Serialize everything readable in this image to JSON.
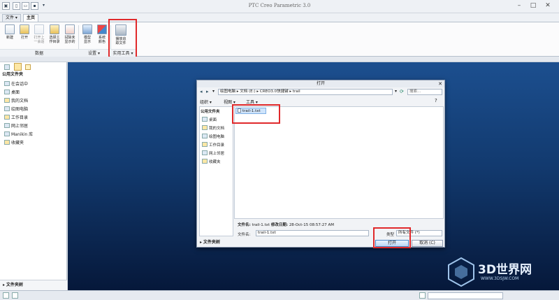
{
  "app": {
    "title": "PTC Creo Parametric 3.0"
  },
  "tabs": [
    {
      "label": "文件 ▾"
    },
    {
      "label": "主页"
    }
  ],
  "ribbon": {
    "buttons": [
      {
        "label": "新建"
      },
      {
        "label": "打开"
      },
      {
        "label": "打开上\n一会话"
      },
      {
        "label": "选择工\n作目录"
      },
      {
        "label": "拭除未\n显示的"
      },
      {
        "label": "模型\n显示"
      },
      {
        "label": "系统\n颜色"
      },
      {
        "label": "播放追\n踪文件"
      }
    ],
    "groups": [
      {
        "label": "数据"
      },
      {
        "label": "设置 ▾"
      },
      {
        "label": "实用工具 ▾"
      }
    ]
  },
  "left_panel": {
    "header": "公用文件夹",
    "items": [
      {
        "label": "在会话中"
      },
      {
        "label": "桌面"
      },
      {
        "label": "我的文档"
      },
      {
        "label": "绘图电脑"
      },
      {
        "label": "工作目录"
      },
      {
        "label": "网上邻居"
      },
      {
        "label": "Manikin 库"
      },
      {
        "label": "收藏夹"
      }
    ],
    "footer": "文件夹树"
  },
  "dialog": {
    "title": "打开",
    "path": "绘图电脑 ▸ 文档 (E:) ▸ CREO3.0快捷键 ▸ trail",
    "search_placeholder": "搜索...",
    "toolbar": {
      "organize": "组织 ▾",
      "views": "视图 ▾",
      "tools": "工具 ▾"
    },
    "sidebar_header": "公用文件夹",
    "sidebar_items": [
      {
        "label": "桌面"
      },
      {
        "label": "我的文档"
      },
      {
        "label": "绘图电脑"
      },
      {
        "label": "工作目录"
      },
      {
        "label": "网上邻居"
      },
      {
        "label": "收藏夹"
      }
    ],
    "files": [
      {
        "name": "trail-1.txt"
      }
    ],
    "info": {
      "file_label": "文件名:",
      "file_value": "trail-1.txt",
      "date_label": "修改日期:",
      "date_value": "28-Oct-15 08:57:27 AM"
    },
    "filename_label": "文件名:",
    "filename_value": "trail-1.txt",
    "type_label": "类型",
    "type_value": "所有文件 (*)",
    "open_button": "打开",
    "cancel_button": "取消 (C)",
    "folder_tree": "文件夹树"
  },
  "watermark": {
    "text": "3D世界网",
    "sub": "WWW.3DSJW.COM"
  },
  "colors": {
    "accent_red": "#e0292b",
    "graphics_top": "#1c4f8f",
    "graphics_bottom": "#06183a"
  }
}
